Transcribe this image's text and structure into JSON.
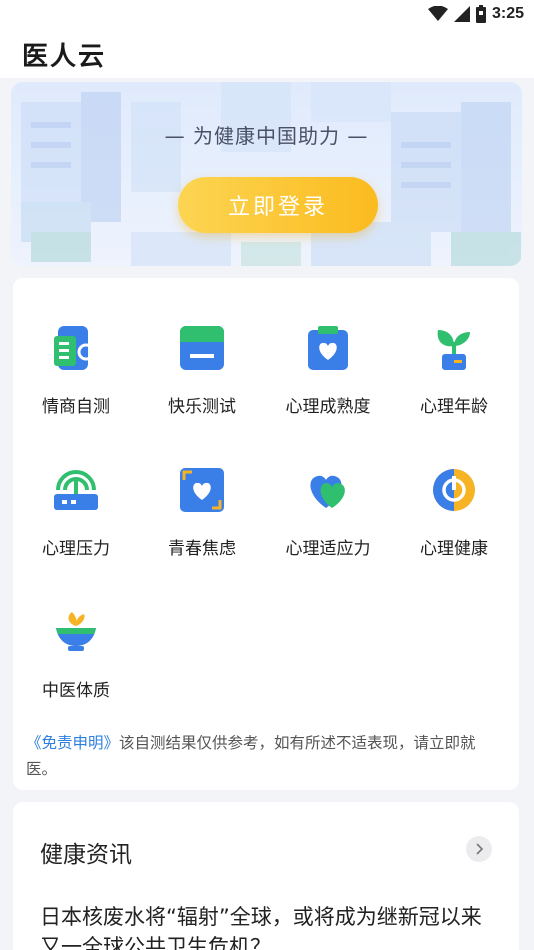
{
  "status_bar": {
    "time": "3:25",
    "icons": [
      "wifi-icon",
      "signal-icon",
      "battery-icon"
    ]
  },
  "header": {
    "title": "医人云"
  },
  "banner": {
    "slogan": "— 为健康中国助力 —",
    "login_button": "立即登录",
    "button_color": "#fbc02d"
  },
  "tests": {
    "items": [
      {
        "label": "情商自测",
        "icon": "eq-icon"
      },
      {
        "label": "快乐测试",
        "icon": "tray-icon"
      },
      {
        "label": "心理成熟度",
        "icon": "clipboard-heart-icon"
      },
      {
        "label": "心理年龄",
        "icon": "sprout-icon"
      },
      {
        "label": "心理压力",
        "icon": "pressure-icon"
      },
      {
        "label": "青春焦虑",
        "icon": "frame-heart-icon"
      },
      {
        "label": "心理适应力",
        "icon": "heart-icon"
      },
      {
        "label": "心理健康",
        "icon": "power-circle-icon"
      },
      {
        "label": "中医体质",
        "icon": "herb-bowl-icon"
      }
    ],
    "disclaimer_link": "《免责申明》",
    "disclaimer_text": "该自测结果仅供参考，如有所述不适表现，请立即就医。"
  },
  "news": {
    "title": "健康资讯",
    "more_icon": "chevron-right-icon",
    "items": [
      {
        "title": "日本核废水将“辐射”全球，或将成为继新冠以来又一全球公共卫生危机？"
      }
    ]
  },
  "colors": {
    "accent_blue": "#2f7fe0",
    "icon_green": "#2fbf6e",
    "icon_blue": "#3a7ee8",
    "icon_yellow": "#f6b324"
  }
}
